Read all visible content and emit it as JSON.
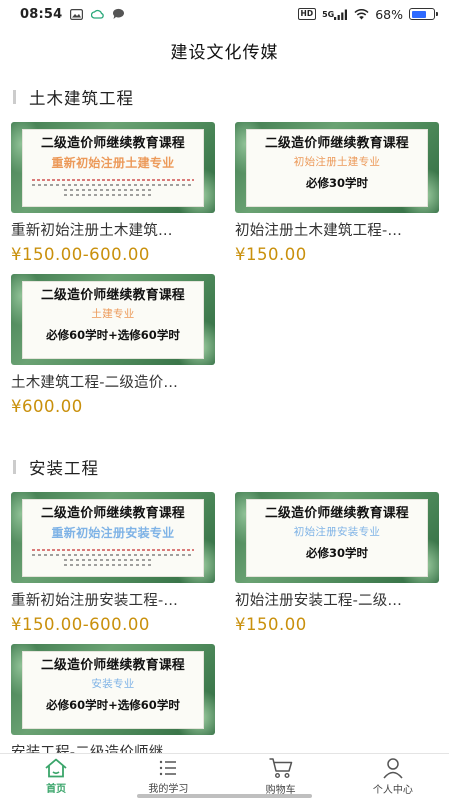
{
  "status_bar": {
    "time": "08:54",
    "hd": "HD",
    "network": "5G",
    "battery": "68%",
    "battery_level": 0.68
  },
  "header": {
    "title": "建设文化传媒"
  },
  "sections": [
    {
      "title": "土木建筑工程",
      "items": [
        {
          "thumb_title": "二级造价师继续教育课程",
          "thumb_sub": "重新初始注册土建专业",
          "name": "重新初始注册土木建筑…",
          "price": "¥150.00-600.00"
        },
        {
          "thumb_title": "二级造价师继续教育课程",
          "thumb_sub": "初始注册土建专业",
          "thumb_note": "必修30学时",
          "name": "初始注册土木建筑工程-…",
          "price": "¥150.00"
        },
        {
          "thumb_title": "二级造价师继续教育课程",
          "thumb_sub": "土建专业",
          "thumb_note": "必修60学时+选修60学时",
          "name": "土木建筑工程-二级造价…",
          "price": "¥600.00"
        }
      ]
    },
    {
      "title": "安装工程",
      "items": [
        {
          "thumb_title": "二级造价师继续教育课程",
          "thumb_sub": "重新初始注册安装专业",
          "name": "重新初始注册安装工程-…",
          "price": "¥150.00-600.00"
        },
        {
          "thumb_title": "二级造价师继续教育课程",
          "thumb_sub": "初始注册安装专业",
          "thumb_note": "必修30学时",
          "name": "初始注册安装工程-二级…",
          "price": "¥150.00"
        },
        {
          "thumb_title": "二级造价师继续教育课程",
          "thumb_sub": "安装专业",
          "thumb_note": "必修60学时+选修60学时",
          "name": "安装工程-二级造价师继…",
          "price": ""
        }
      ]
    }
  ],
  "tabs": [
    {
      "label": "首页",
      "icon": "home-icon",
      "active": true
    },
    {
      "label": "我的学习",
      "icon": "list-icon",
      "active": false
    },
    {
      "label": "购物车",
      "icon": "cart-icon",
      "active": false
    },
    {
      "label": "个人中心",
      "icon": "person-icon",
      "active": false
    }
  ],
  "colors": {
    "accent": "#3aa56a",
    "price": "#c9900c",
    "battery": "#2f6bff"
  }
}
